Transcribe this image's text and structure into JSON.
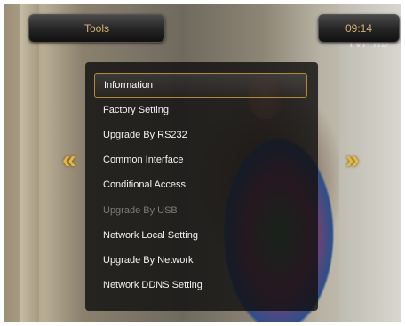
{
  "header": {
    "title": "Tools",
    "clock": "09:14"
  },
  "channel_logo": "TVP HD",
  "navigation": {
    "left_arrow_icon": "double-chevron-left-icon",
    "right_arrow_icon": "double-chevron-right-icon",
    "left_glyph": "«",
    "right_glyph": "»"
  },
  "menu": {
    "items": [
      {
        "label": "Information",
        "state": "selected"
      },
      {
        "label": "Factory Setting",
        "state": "normal"
      },
      {
        "label": "Upgrade By RS232",
        "state": "normal"
      },
      {
        "label": "Common Interface",
        "state": "normal"
      },
      {
        "label": "Conditional Access",
        "state": "normal"
      },
      {
        "label": "Upgrade By USB",
        "state": "disabled"
      },
      {
        "label": "Network Local Setting",
        "state": "normal"
      },
      {
        "label": "Upgrade By Network",
        "state": "normal"
      },
      {
        "label": "Network DDNS Setting",
        "state": "normal"
      }
    ]
  },
  "colors": {
    "accent": "#d6b36a",
    "selection_border": "#b38a2e",
    "disabled_text": "#7a7a7a"
  }
}
